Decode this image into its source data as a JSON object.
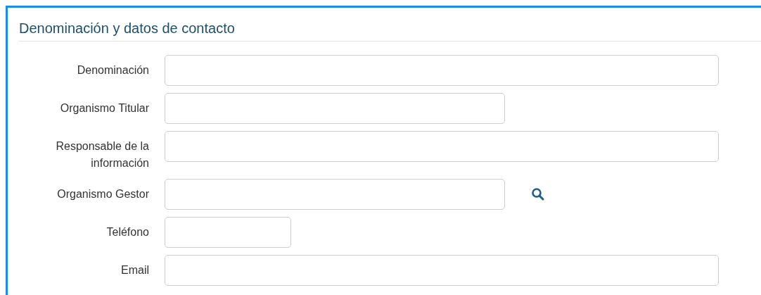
{
  "section": {
    "title": "Denominación y datos de contacto"
  },
  "fields": [
    {
      "label": "Denominación",
      "kind": "wide"
    },
    {
      "label": "Organismo Titular",
      "kind": "medium"
    },
    {
      "label": "Responsable de la información",
      "kind": "wide"
    },
    {
      "label": "Organismo Gestor",
      "kind": "lookup"
    },
    {
      "label": "Teléfono",
      "kind": "short"
    },
    {
      "label": "Email",
      "kind": "wide"
    }
  ]
}
